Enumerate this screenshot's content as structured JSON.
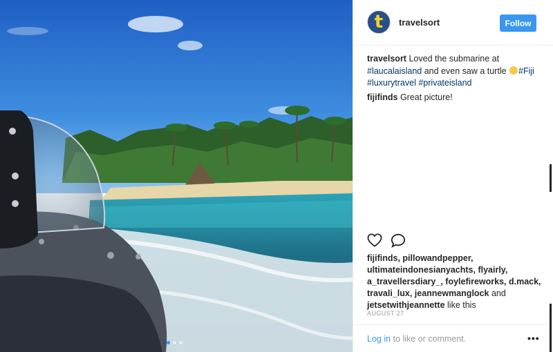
{
  "post": {
    "image_alt": "Submarine window view of tropical island beach with palm trees",
    "carousel_dots": 3,
    "active_dot": 1
  },
  "header": {
    "avatar_letter": "t",
    "username": "travelsort",
    "follow_label": "Follow"
  },
  "comments": [
    {
      "user": "travelsort",
      "text_parts": {
        "intro": "Loved the submarine at",
        "tag1": "#laucalaisland",
        "mid": "and even saw a turtle",
        "tag2": "#Fiji",
        "tag3": "#luxurytravel",
        "tag4": "#privateisland"
      }
    },
    {
      "user": "fijifinds",
      "text": "Great picture!"
    }
  ],
  "actions": {
    "like_icon": "heart-icon",
    "comment_icon": "comment-icon"
  },
  "likes": {
    "names": "fijifinds, pillowandpepper, ultimateindonesianyachts, flyairly, a_travellersdiary_, foylefireworks, d.mack, travali_lux, jeannewmanglock",
    "and": "and",
    "last": "jetsetwithjeannette",
    "suffix": "like this"
  },
  "date": "AUGUST 27",
  "footer": {
    "login_link": "Log in",
    "login_text": "to like or comment.",
    "more": "•••"
  },
  "colors": {
    "accent": "#3897f0",
    "tag": "#003569"
  }
}
